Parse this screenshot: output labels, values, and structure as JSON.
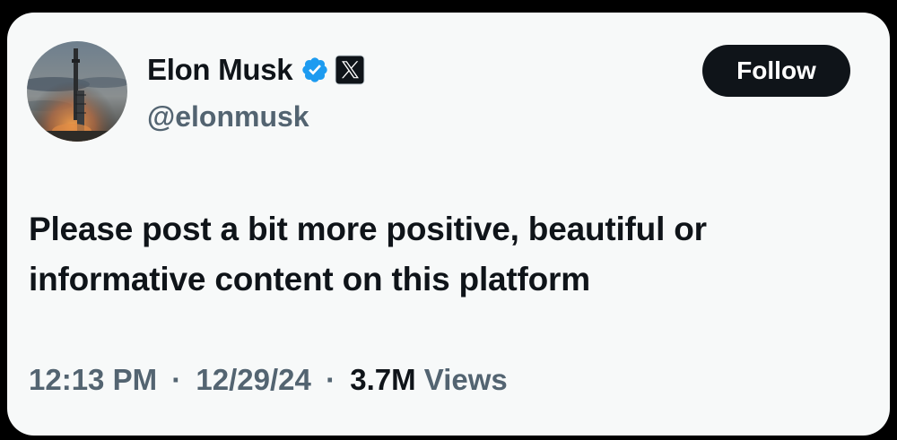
{
  "author": {
    "display_name": "Elon Musk",
    "handle": "@elonmusk",
    "verified_badge_color": "#1d9bf0",
    "verified_icon": "verified-badge-icon",
    "affiliation_icon": "x-logo-icon"
  },
  "actions": {
    "follow_label": "Follow"
  },
  "post": {
    "text": "Please post a bit more positive, beautiful or informative content on this platform"
  },
  "meta": {
    "time": "12:13 PM",
    "separator": "·",
    "date": "12/29/24",
    "views_count": "3.7M",
    "views_label": "Views"
  },
  "colors": {
    "background": "#f7f9f9",
    "text_primary": "#0f1419",
    "text_secondary": "#536471",
    "button_bg": "#0f1419"
  }
}
